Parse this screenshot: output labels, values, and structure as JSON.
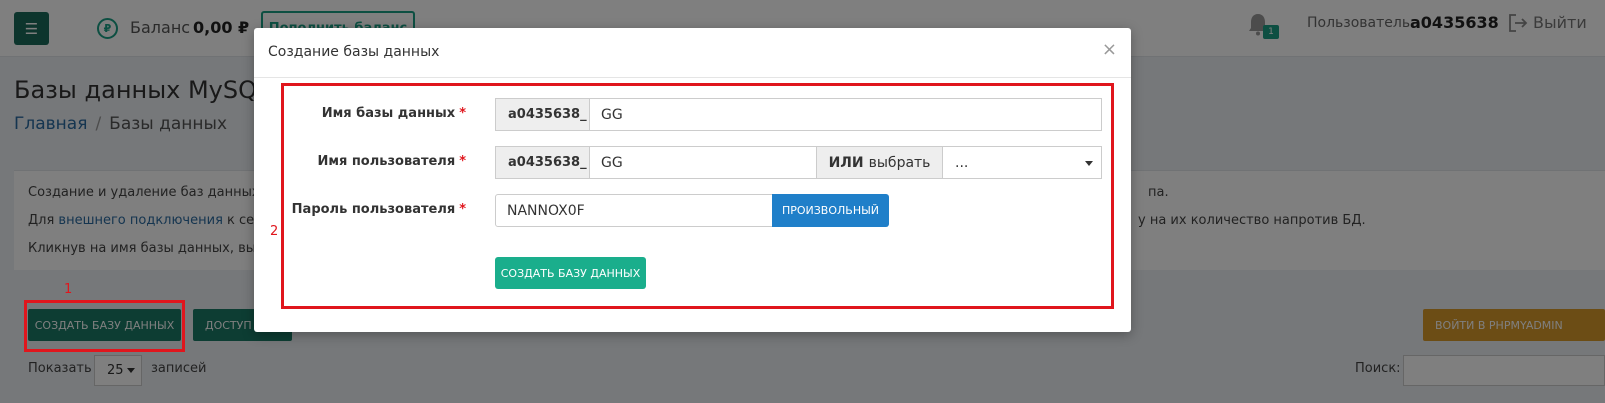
{
  "header": {
    "menu_icon": "hamburger-icon",
    "balance_currency_symbol": "₽",
    "balance_label": "Баланс",
    "balance_value": "0,00 ₽",
    "topup_label": "Пополнить баланс",
    "notifications_count": "1",
    "user_label": "Пользователь",
    "user_name": "a0435638",
    "logout_label": "Выйти"
  },
  "page": {
    "title": "Базы данных MySQL",
    "breadcrumb": {
      "home": "Главная",
      "separator": "/",
      "current": "Базы данных"
    }
  },
  "info": {
    "line1": "Создание и удаление баз данных до",
    "line1_tail": "па.",
    "line2_prefix": "Для ",
    "line2_link": "внешнего подключения",
    "line2_suffix": " к серве",
    "line2_tail": "у на их количество напротив БД.",
    "line3": "Кликнув на имя базы данных, вы мо"
  },
  "toolbar": {
    "create_db_label": "СОЗДАТЬ БАЗУ ДАННЫХ",
    "access_label": "ДОСТУП",
    "phpmyadmin_label": "ВОЙТИ В PHPMYADMIN",
    "show_label": "Показать",
    "page_size": "25",
    "records_label": "записей",
    "search_label": "Поиск:"
  },
  "annotations": {
    "num1": "1",
    "num2": "2"
  },
  "modal": {
    "title": "Создание базы данных",
    "close_symbol": "×",
    "required_marker": "*",
    "db_name": {
      "label": "Имя базы данных",
      "prefix": "a0435638_",
      "value": "GG"
    },
    "user_name": {
      "label": "Имя пользователя",
      "prefix": "a0435638_",
      "value": "GG",
      "or_label": "ИЛИ",
      "choose_label": "выбрать",
      "select_value": "..."
    },
    "password": {
      "label": "Пароль пользователя",
      "value": "NANNOX0F",
      "random_label": "ПРОИЗВОЛЬНЫЙ"
    },
    "submit_label": "СОЗДАТЬ БАЗУ ДАННЫХ"
  },
  "colors": {
    "primary_green": "#1a7a66",
    "accent_teal": "#1aae8c",
    "blue": "#1f7fc9",
    "orange": "#d99a2b",
    "annotation_red": "#e0161d"
  }
}
